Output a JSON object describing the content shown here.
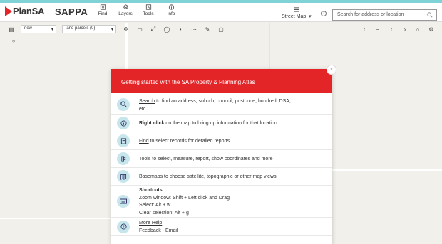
{
  "header": {
    "logo_text": "PlanSA",
    "app_name": "SAPPA",
    "nav": [
      {
        "label": "Find",
        "icon": "find-icon"
      },
      {
        "label": "Layers",
        "icon": "layers-icon"
      },
      {
        "label": "Tools",
        "icon": "tools-icon"
      },
      {
        "label": "Info",
        "icon": "info-icon"
      }
    ],
    "basemap_label": "Street Map",
    "search_placeholder": "Search for address or location"
  },
  "toolbar": {
    "select_new": "new",
    "select_layer": "land parcels (0)"
  },
  "modal": {
    "title": "Getting started with the SA Property & Planning Atlas",
    "rows": [
      {
        "link": "Search",
        "text": " to find an address, suburb, council, postcode, hundred, DSA,",
        "text2": "etc",
        "icon": "search-icon"
      },
      {
        "bold": "Right click",
        "text": " on the map to bring up information for that location",
        "icon": "info-icon"
      },
      {
        "link": "Find",
        "text": " to select records for detailed reports",
        "icon": "find-icon"
      },
      {
        "link": "Tools",
        "text": " to select, measure, report, show coordinates and more",
        "icon": "tools-icon"
      },
      {
        "link": "Basemaps",
        "text": " to choose satellite, topographic or other map views",
        "icon": "map-icon"
      }
    ],
    "shortcuts": {
      "title": "Shortcuts",
      "lines": [
        "Zoom window: Shift + Left click and Drag",
        "Select: Alt + w",
        "Clear selection: Alt + g"
      ]
    },
    "help_links": [
      "More Help",
      "Feedback - Email"
    ]
  },
  "colors": {
    "accent_red": "#e42528",
    "top_stripe": "#7fd3d6",
    "bubble": "#c7e6ec",
    "map_bg": "#f2f0eb"
  }
}
